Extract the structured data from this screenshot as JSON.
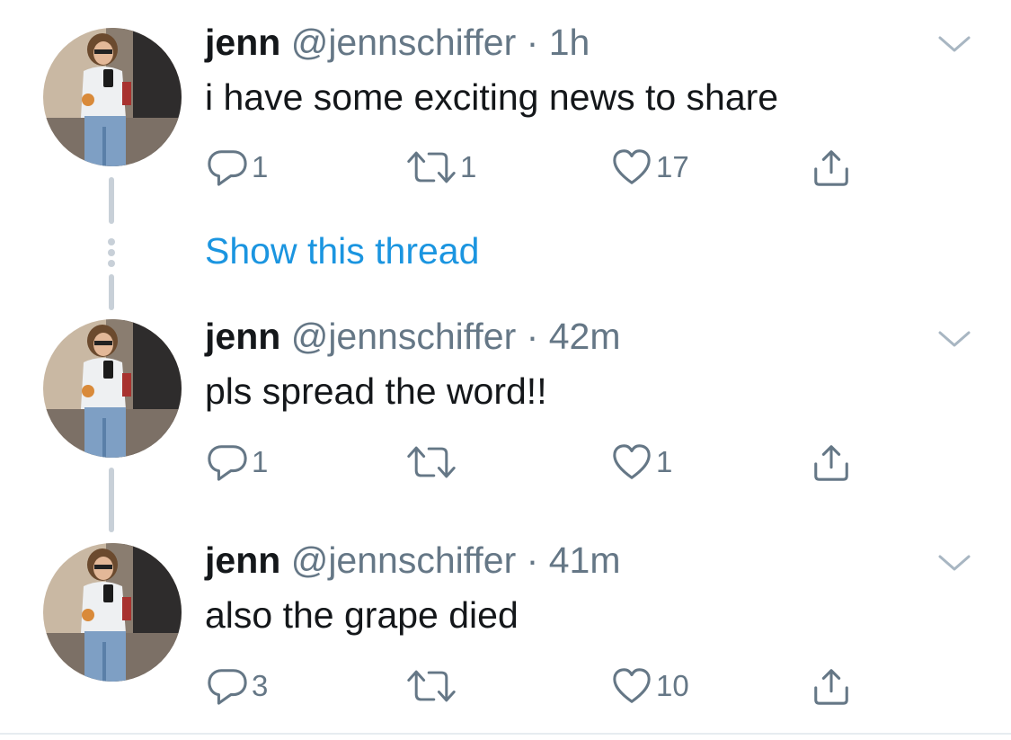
{
  "thread_link": {
    "label": "Show this thread"
  },
  "tweets": [
    {
      "name": "jenn",
      "handle": "@jennschiffer",
      "separator": "·",
      "time": "1h",
      "text": "i have some exciting news to share",
      "replies": "1",
      "retweets": "1",
      "likes": "17"
    },
    {
      "name": "jenn",
      "handle": "@jennschiffer",
      "separator": "·",
      "time": "42m",
      "text": "pls spread the word!!",
      "replies": "1",
      "retweets": "",
      "likes": "1"
    },
    {
      "name": "jenn",
      "handle": "@jennschiffer",
      "separator": "·",
      "time": "41m",
      "text": "also the grape died",
      "replies": "3",
      "retweets": "",
      "likes": "10"
    }
  ],
  "icons": {
    "reply": "reply-icon",
    "retweet": "retweet-icon",
    "like": "heart-icon",
    "share": "share-icon",
    "more": "chevron-down-icon"
  },
  "colors": {
    "icon_gray": "#657786",
    "link_blue": "#1b95e0",
    "text": "#14171a",
    "thread_line": "#c8d0d8"
  }
}
